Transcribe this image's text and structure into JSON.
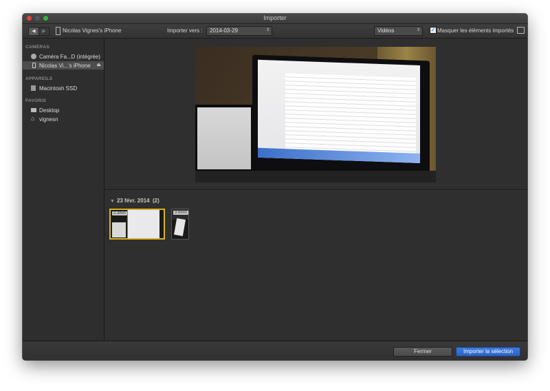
{
  "window": {
    "title": "Importer"
  },
  "toolbar": {
    "device_name": "Nicolas Vignes's iPhone",
    "import_to_label": "Importer vers :",
    "import_to_value": "2014-03-29",
    "type_value": "Vidéos",
    "hide_imported_label": "Masquer les éléments importés",
    "hide_imported_checked": true
  },
  "sidebar": {
    "sections": [
      {
        "title": "CAMÉRAS",
        "items": [
          {
            "label": "Caméra Fa...D (intégrée)",
            "icon": "camera-icon",
            "selected": false
          },
          {
            "label": "Nicolas Vi...'s iPhone",
            "icon": "phone-icon",
            "selected": true,
            "eject": true
          }
        ]
      },
      {
        "title": "APPAREILS",
        "items": [
          {
            "label": "Macintosh SSD",
            "icon": "disk-icon",
            "selected": false
          }
        ]
      },
      {
        "title": "FAVORIS",
        "items": [
          {
            "label": "Desktop",
            "icon": "desktop-icon",
            "selected": false
          },
          {
            "label": "vignesn",
            "icon": "home-icon",
            "selected": false
          }
        ]
      }
    ]
  },
  "browser": {
    "group_date": "23 févr. 2014",
    "group_count": "(2)",
    "clips": [
      {
        "duration": "2.3min",
        "selected": true
      },
      {
        "duration": "3.6min",
        "selected": false
      }
    ]
  },
  "footer": {
    "close_label": "Fermer",
    "import_label": "Importer la sélection"
  },
  "colors": {
    "accent": "#2f6bd1",
    "selection": "#d8b31f"
  }
}
